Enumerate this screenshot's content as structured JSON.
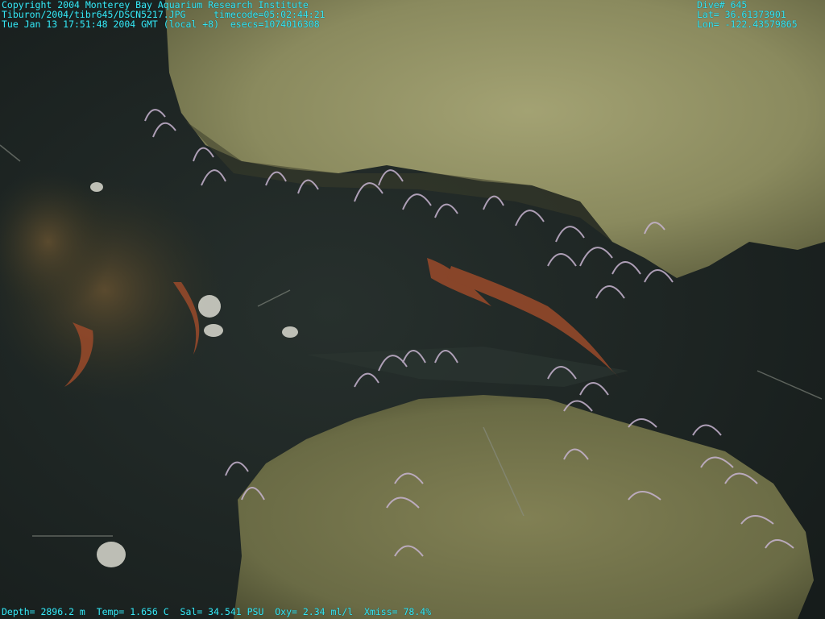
{
  "overlay": {
    "top_left": {
      "line1": "Copyright 2004 Monterey Bay Aquarium Research Institute",
      "line2": "Tiburon/2004/tibr645/DSCN5217.JPG     timecode=05:02:44:21",
      "line3": "Tue Jan 13 17:51:48 2004 GMT (local +8)  esecs=1074016308"
    },
    "top_right": {
      "dive": "Dive# 645",
      "lat": "Lat= 36.61373901",
      "lon": "Lon= -122.43579865"
    },
    "bottom": {
      "sensors": "Depth= 2896.2 m  Temp= 1.656 C  Sal= 34.541 PSU  Oxy= 2.34 ml/l  Xmiss= 78.4%"
    },
    "text_color": "#39e6f2"
  },
  "scene": {
    "description_colors": {
      "sediment": "#1f2725",
      "boulder_upper": "#8a8a5e",
      "boulder_lower": "#6f7048",
      "anemone": "#b9a6c4",
      "rust_growth": "#9a4a2a"
    }
  }
}
